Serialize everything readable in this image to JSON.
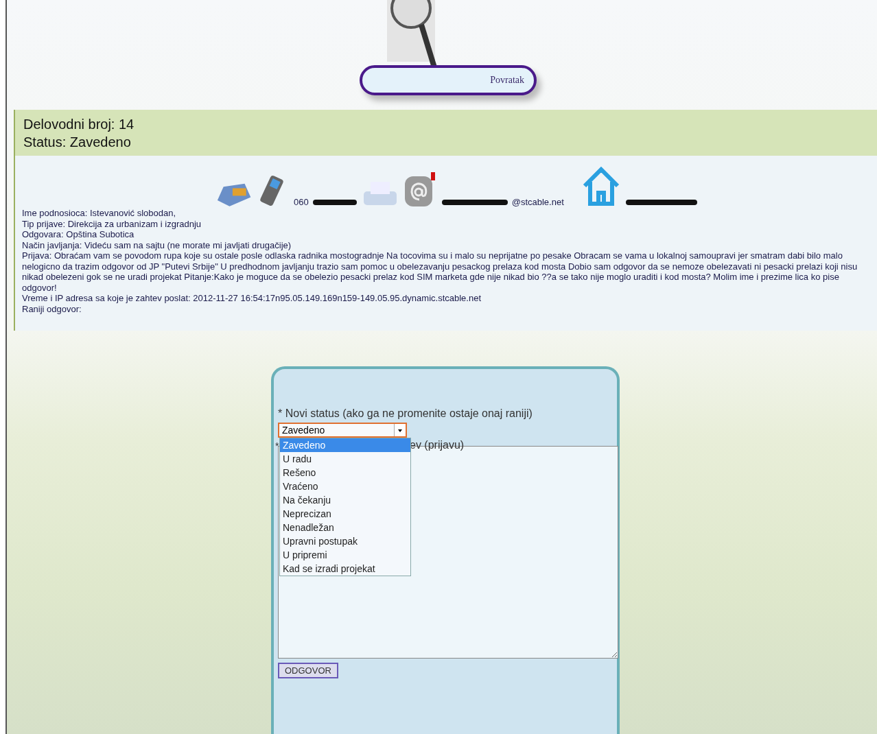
{
  "header": {
    "back_button": "Povratak"
  },
  "record": {
    "number": "Delovodni broj: 14",
    "status": "Status: Zavedeno"
  },
  "contacts": {
    "phone": "060",
    "email": "@stcable.net"
  },
  "details": [
    "Ime podnosioca: Istevanović slobodan,",
    "Tip prijave: Direkcija za urbanizam i izgradnju",
    "Odgovara: Opština Subotica",
    "Način javljanja: Videću sam na sajtu (ne morate mi javljati drugačije)",
    "Prijava: Obraćam vam se povodom rupa koje su ostale posle odlaska radnika mostogradnje Na tocovima su i malo su neprijatne po pesake Obracam se vama u lokalnoj samoupravi jer smatram dabi bilo malo nelogicno da trazim odgovor od JP \"Putevi Srbije\" U predhodnom javljanju trazio sam pomoc u obelezavanju pesackog prelaza kod mosta Dobio sam odgovor da se nemoze obelezavati ni pesacki prelazi koji nisu nikad obelezeni gok se ne uradi projekat Pitanje:Kako je moguce da se obelezio pesacki prelaz kod SIM marketa gde nije nikad bio ??a se tako nije moglo uraditi i kod mosta? Molim ime i prezime lica ko pise odgovor!",
    "Vreme i IP adresa sa koje je zahtev poslat: 2012-11-27 16:54:17n95.05.149.169n159-149.05.95.dynamic.stcable.net",
    "Raniji odgovor:"
  ],
  "form": {
    "status_label": "* Novi status (ako ga ne promenite ostaje onaj raniji)",
    "status_value": "Zavedeno",
    "options": [
      {
        "label": "Zavedeno",
        "selected": true
      },
      {
        "label": "U radu",
        "selected": false
      },
      {
        "label": "Rešeno",
        "selected": false
      },
      {
        "label": "Vraćeno",
        "selected": false
      },
      {
        "label": "Na čekanju",
        "selected": false
      },
      {
        "label": "Neprecizan",
        "selected": false
      },
      {
        "label": "Nenadležan",
        "selected": false
      },
      {
        "label": "Upravni postupak",
        "selected": false
      },
      {
        "label": "U pripremi",
        "selected": false
      },
      {
        "label": "Kad se izradi projekat",
        "selected": false
      }
    ],
    "answer_label_star": "*",
    "answer_label": "ev (prijavu)",
    "submit": "ODGOVOR"
  }
}
